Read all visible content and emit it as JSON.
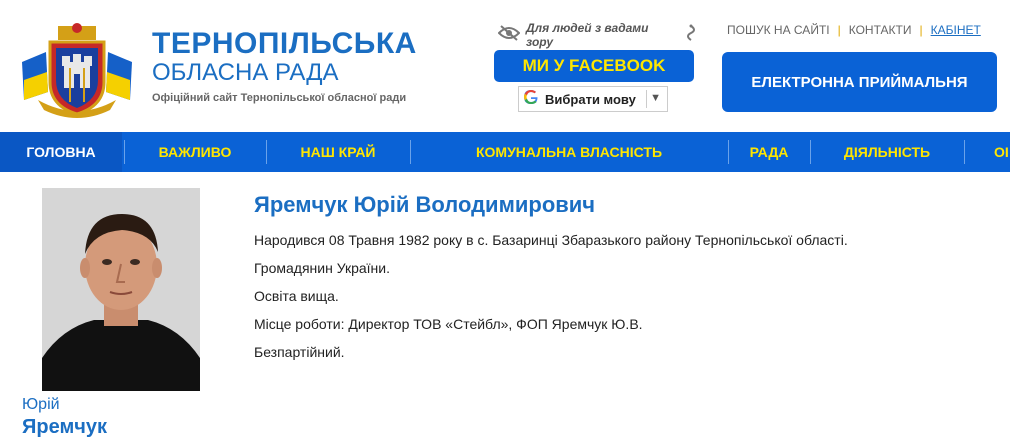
{
  "header": {
    "title_main": "ТЕРНОПІЛЬСЬКА",
    "title_sub": "ОБЛАСНА РАДА",
    "title_desc": "Офіційний сайт Тернопільської обласної ради",
    "vision_label": "Для людей з вадами зору",
    "facebook_label": "МИ У FACEBOOK",
    "language_label": "Вибрати мову",
    "links": {
      "search": "ПОШУК НА САЙТІ",
      "contacts": "КОНТАКТИ",
      "cabinet": "КАБІНЕТ"
    },
    "reception_label": "ЕЛЕКТРОННА ПРИЙМАЛЬНЯ",
    "icons": [
      "eye-icon",
      "pinwheel-icon",
      "google-g-icon",
      "chevron-down-icon"
    ]
  },
  "nav": {
    "items": [
      {
        "label": "ГОЛОВНА"
      },
      {
        "label": "ВАЖЛИВО"
      },
      {
        "label": "НАШ КРАЙ"
      },
      {
        "label": "КОМУНАЛЬНА ВЛАСНІСТЬ"
      },
      {
        "label": "РАДА"
      },
      {
        "label": "ДІЯЛЬНІСТЬ"
      },
      {
        "label": "ОІ"
      }
    ]
  },
  "person": {
    "first_name": "Юрій",
    "last_name": "Яремчук",
    "full_name": "Яремчук Юрій Володимирович",
    "bio": [
      "Народився 08 Травня 1982 року в с. Базаринці Збаразького району Тернопільської області.",
      "Громадянин України.",
      "Освіта вища.",
      "Місце роботи: Директор ТОВ «Стейбл», ФОП Яремчук Ю.В.",
      "Безпартійний."
    ]
  },
  "colors": {
    "brand_blue": "#1b6ec2",
    "nav_blue": "#0a62d6",
    "nav_text": "#ffe600"
  }
}
